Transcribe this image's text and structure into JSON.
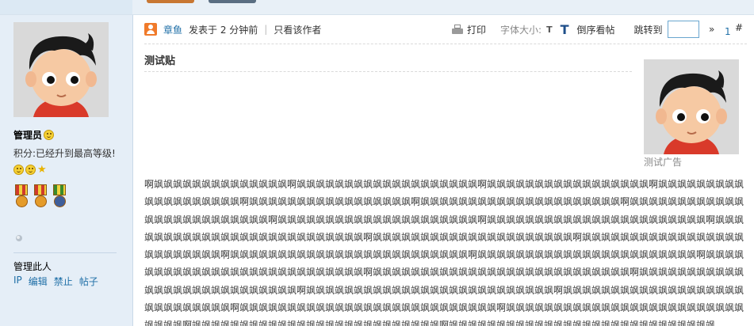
{
  "sidebar": {
    "username": "管理员",
    "score_text": "积分:已经升到最高等级!",
    "manage_title": "管理此人",
    "manage_links": [
      "IP",
      "编辑",
      "禁止",
      "帖子"
    ]
  },
  "post_header": {
    "author": "章鱼",
    "posted_text": "发表于 2 分钟前",
    "separator": "|",
    "only_author": "只看该作者",
    "print_label": "打印",
    "font_size_label": "字体大小:",
    "font_small": "T",
    "font_large": "T",
    "reverse_label": "倒序看帖",
    "jump_label": "跳转到",
    "jump_value": "",
    "jump_arrow": "»",
    "floor_number": "1",
    "floor_hash": "#"
  },
  "post": {
    "title": "测试贴",
    "ad_label": "测试广告",
    "body": "啊飒飒飒飒飒飒飒飒飒飒飒飒飒飒啊飒飒飒飒飒飒飒飒飒飒飒飒飒飒飒飒飒飒飒啊飒飒飒飒飒飒飒飒飒飒飒飒飒飒飒飒飒啊飒飒飒飒飒飒飒飒飒飒飒飒飒飒飒飒飒飒飒啊飒飒飒飒飒飒飒飒飒飒飒飒飒飒飒飒飒啊飒飒飒飒飒飒飒飒飒飒飒飒飒飒飒飒飒飒飒飒飒啊飒飒飒飒飒飒飒飒飒飒飒飒飒飒飒飒飒飒飒飒飒飒飒飒飒啊飒飒飒飒飒飒飒飒飒飒飒飒飒飒飒飒飒飒飒飒飒啊飒飒飒飒飒飒飒飒飒飒飒飒飒飒飒飒飒飒飒飒飒飒飒啊飒飒飒飒飒飒飒飒飒飒飒飒飒飒飒飒飒飒飒飒飒飒飒飒飒飒啊飒飒飒飒飒飒飒飒飒飒飒飒飒飒飒飒飒飒飒飒飒啊飒飒飒飒飒飒飒飒飒飒飒飒飒飒飒飒飒飒飒飒飒飒飒飒飒啊飒飒飒飒飒飒飒飒飒飒飒飒飒飒飒飒飒飒飒飒飒飒飒飒飒啊飒飒飒飒飒飒飒飒飒飒飒飒飒飒飒飒飒飒飒飒飒飒飒啊飒飒飒飒飒飒飒飒飒飒飒飒飒飒飒飒飒飒飒飒飒飒飒飒飒飒飒啊飒飒飒飒飒飒飒飒飒飒飒飒飒飒飒飒飒飒飒飒飒飒飒飒飒飒飒啊飒飒飒飒飒飒飒飒飒飒飒飒飒飒飒飒飒飒飒飒飒飒飒飒飒飒飒啊飒飒飒飒飒飒飒飒飒飒飒飒飒飒飒飒飒飒飒飒飒飒飒飒飒飒啊飒飒飒飒飒飒飒飒飒飒飒飒飒飒飒飒飒飒飒飒飒飒飒飒飒飒飒飒啊飒飒飒飒飒飒飒飒飒飒飒飒飒飒飒飒飒飒飒飒飒飒飒飒飒飒飒啊飒飒飒飒飒飒飒飒飒飒飒飒飒飒飒飒飒飒飒飒飒飒飒飒飒飒飒飒飒啊飒飒飒飒飒飒飒飒飒飒飒飒飒飒飒飒飒飒飒飒飒飒飒飒飒飒啊飒飒飒飒飒飒飒飒飒飒飒飒飒飒飒飒飒飒飒飒飒飒飒飒飒飒飒飒"
  },
  "colors": {
    "link": "#1f6fa7",
    "sidebar_bg": "#e5eef7",
    "topbar_bg": "#e8f0f7",
    "accent_orange": "#f07a2a"
  },
  "icons": {
    "author": "user-icon",
    "print": "printer-icon",
    "rank": [
      "smile-icon",
      "smile-icon",
      "star-icon"
    ],
    "medals": [
      "medal-icon",
      "medal-icon",
      "medal-icon"
    ]
  }
}
